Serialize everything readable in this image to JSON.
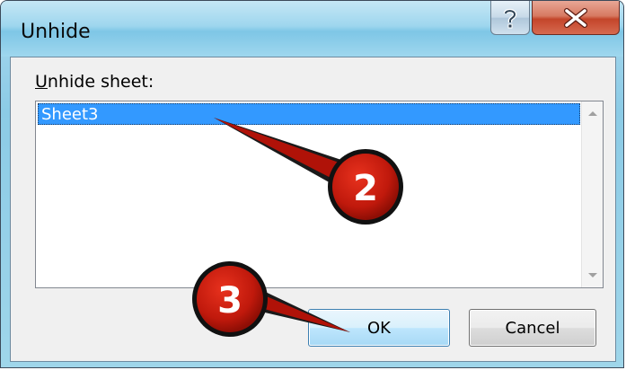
{
  "window": {
    "title": "Unhide"
  },
  "titlebar_buttons": {
    "help_icon": "help-question-icon",
    "close_icon": "close-x-icon"
  },
  "dialog": {
    "label_prefix": "U",
    "label_rest": "nhide sheet:",
    "sheets": [
      "Sheet3"
    ],
    "selected_index": 0,
    "ok_label": "OK",
    "cancel_label": "Cancel"
  },
  "callouts": [
    {
      "number": "2",
      "target": "Sheet3 list item"
    },
    {
      "number": "3",
      "target": "OK button"
    }
  ],
  "colors": {
    "selection": "#3399ff",
    "callout_fill": "#c0190c",
    "close_red": "#c4452a"
  }
}
